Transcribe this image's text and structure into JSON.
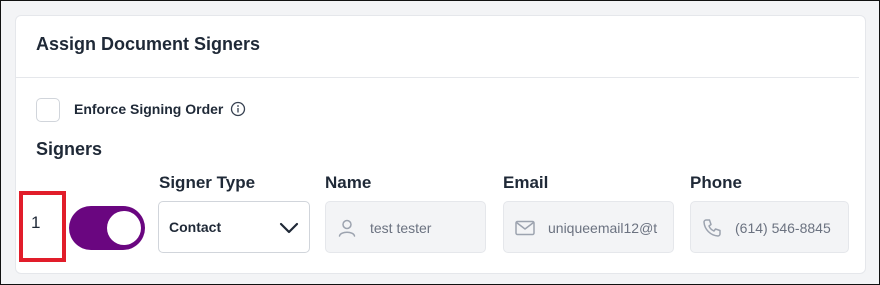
{
  "card": {
    "title": "Assign Document Signers"
  },
  "options": {
    "enforce_order_label": "Enforce Signing Order",
    "enforce_order_checked": false
  },
  "signers": {
    "heading": "Signers",
    "columns": {
      "signer_type": "Signer Type",
      "name": "Name",
      "email": "Email",
      "phone": "Phone"
    },
    "rows": [
      {
        "index": "1",
        "enabled": true,
        "signer_type": "Contact",
        "name": "test tester",
        "email": "uniqueemail12@t",
        "phone": "(614) 546-8845"
      }
    ]
  },
  "icons": {
    "info": "info-icon",
    "chevron": "chevron-down-icon",
    "user": "user-icon",
    "mail": "mail-icon",
    "phone": "phone-icon"
  },
  "colors": {
    "toggle_on": "#6a0680",
    "highlight": "#e11d2a"
  }
}
